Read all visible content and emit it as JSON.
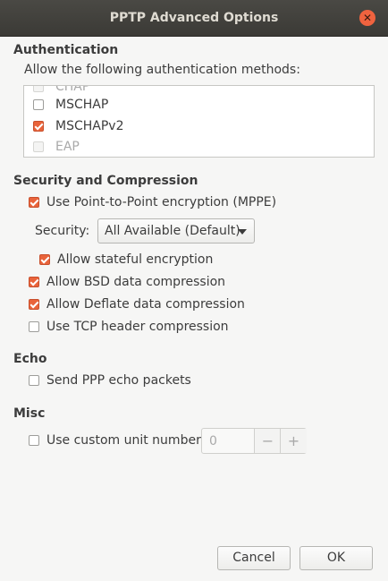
{
  "window": {
    "title": "PPTP Advanced Options",
    "close_glyph": "✕"
  },
  "auth": {
    "title": "Authentication",
    "subtitle": "Allow the following authentication methods:",
    "methods": [
      {
        "label": "CHAP",
        "checked": false,
        "enabled": false
      },
      {
        "label": "MSCHAP",
        "checked": false,
        "enabled": true
      },
      {
        "label": "MSCHAPv2",
        "checked": true,
        "enabled": true
      },
      {
        "label": "EAP",
        "checked": false,
        "enabled": false
      }
    ]
  },
  "security": {
    "title": "Security and Compression",
    "mppe_label": "Use Point-to-Point encryption (MPPE)",
    "mppe_checked": true,
    "security_label": "Security:",
    "security_value": "All Available (Default)",
    "stateful_label": "Allow stateful encryption",
    "stateful_checked": true,
    "bsd_label": "Allow BSD data compression",
    "bsd_checked": true,
    "deflate_label": "Allow Deflate data compression",
    "deflate_checked": true,
    "tcp_label": "Use TCP header compression",
    "tcp_checked": false
  },
  "echo": {
    "title": "Echo",
    "send_label": "Send PPP echo packets",
    "send_checked": false
  },
  "misc": {
    "title": "Misc",
    "unit_label": "Use custom unit number:",
    "unit_checked": false,
    "unit_value": "0",
    "minus": "−",
    "plus": "+"
  },
  "buttons": {
    "cancel": "Cancel",
    "ok": "OK"
  },
  "colors": {
    "accent": "#e9643b",
    "titlebar": "#3b3a36",
    "background": "#f6f6f5"
  }
}
